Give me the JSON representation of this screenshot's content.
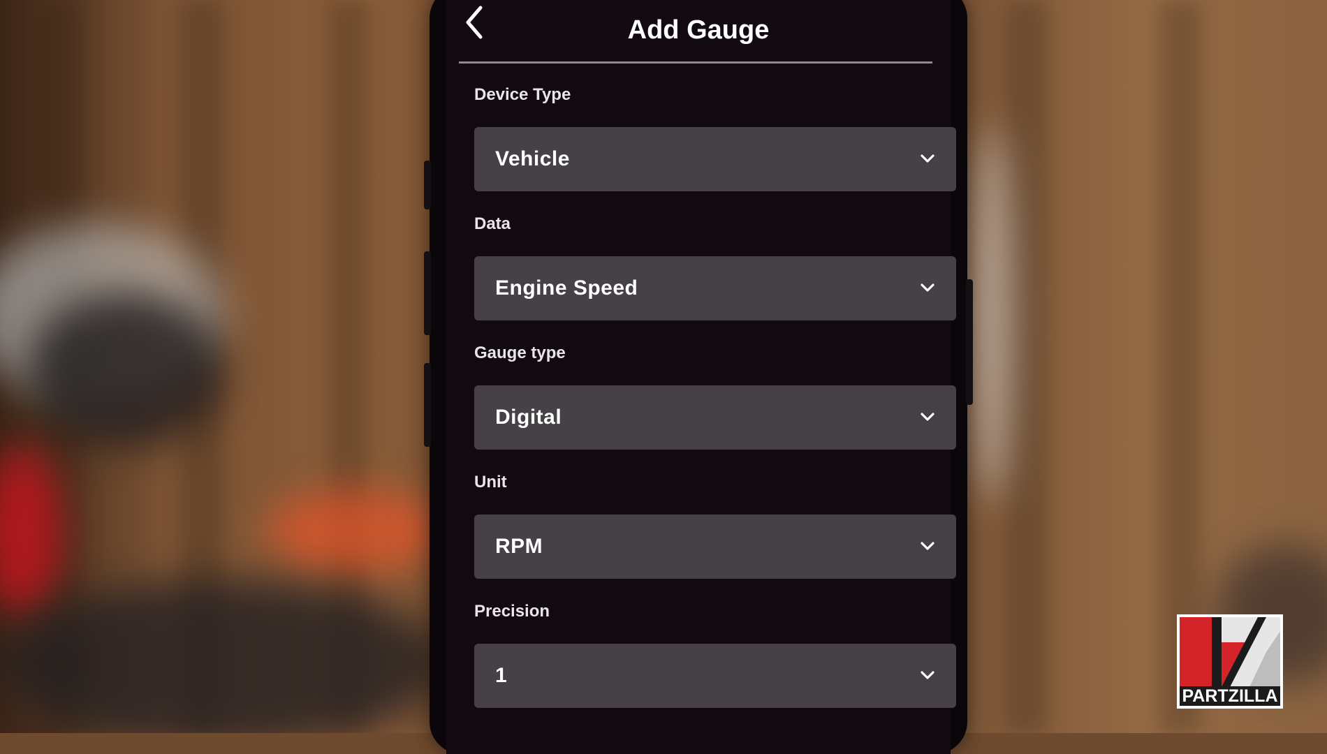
{
  "header": {
    "title": "Add Gauge",
    "back_icon": "chevron-left-icon"
  },
  "form": {
    "device_type": {
      "label": "Device Type",
      "value": "Vehicle"
    },
    "data": {
      "label": "Data",
      "value": "Engine Speed"
    },
    "gauge_type": {
      "label": "Gauge type",
      "value": "Digital"
    },
    "unit": {
      "label": "Unit",
      "value": "RPM"
    },
    "precision": {
      "label": "Precision",
      "value": "1"
    }
  },
  "watermark": {
    "brand": "PARTZILLA"
  },
  "colors": {
    "screen_bg": "#120a10",
    "select_bg": "#454147",
    "text": "#ffffff",
    "brand_red": "#d4242a"
  }
}
